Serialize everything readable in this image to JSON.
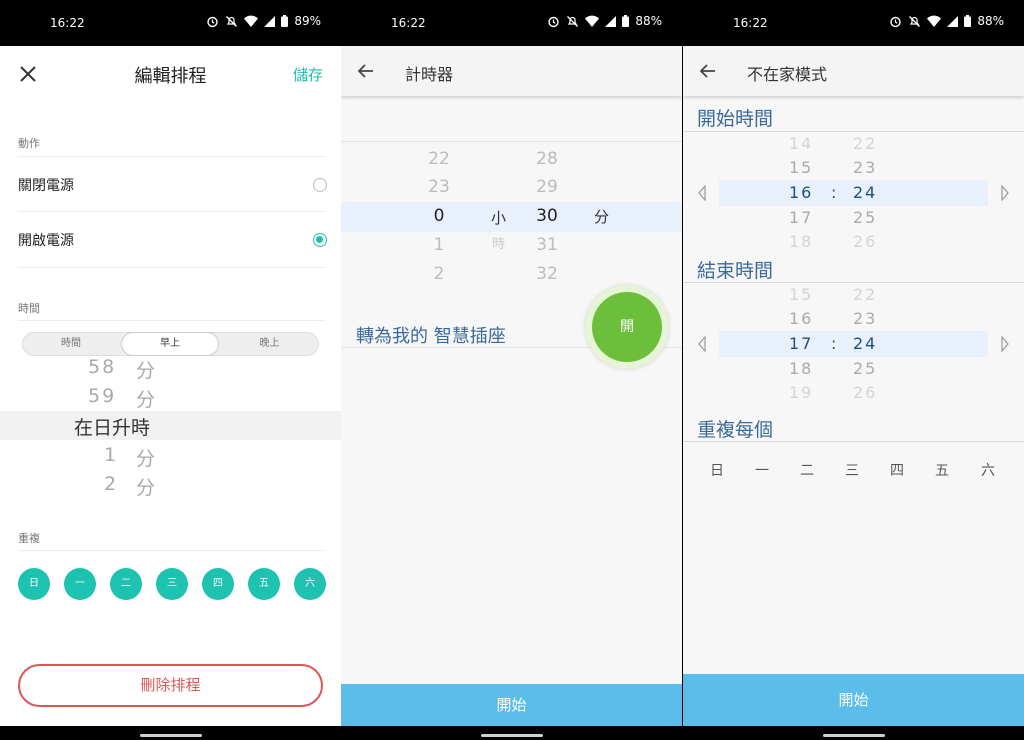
{
  "screens": [
    {
      "status": {
        "time": "16:22",
        "battery": "89%"
      },
      "header": {
        "title": "編輯排程",
        "save": "儲存"
      },
      "action_label": "動作",
      "options": [
        {
          "label": "關閉電源",
          "selected": false
        },
        {
          "label": "開啟電源",
          "selected": true
        }
      ],
      "time_label": "時間",
      "segments": [
        "時間",
        "早上",
        "晚上"
      ],
      "selected_segment": "早上",
      "wheel": {
        "above": [
          {
            "num": "58",
            "unit": "分"
          },
          {
            "num": "59",
            "unit": "分"
          }
        ],
        "selected": "在日升時",
        "below": [
          {
            "num": "1",
            "unit": "分"
          },
          {
            "num": "2",
            "unit": "分"
          }
        ]
      },
      "repeat_label": "重複",
      "days": [
        "日",
        "一",
        "二",
        "三",
        "四",
        "五",
        "六"
      ],
      "delete_label": "刪除排程"
    },
    {
      "status": {
        "time": "16:22",
        "battery": "88%"
      },
      "title": "計時器",
      "hours": {
        "above": [
          "22",
          "23"
        ],
        "selected": "0",
        "below": [
          "1",
          "2"
        ]
      },
      "hour_unit": "小",
      "hour_unit_2": "時",
      "minutes": {
        "above": [
          "28",
          "29"
        ],
        "selected": "30",
        "below": [
          "31",
          "32"
        ]
      },
      "minute_unit": "分",
      "convert_text": "轉為我的 智慧插座",
      "fab_label": "開",
      "start_label": "開始"
    },
    {
      "status": {
        "time": "16:22",
        "battery": "88%"
      },
      "title": "不在家模式",
      "start_time_label": "開始時間",
      "start_picker": {
        "hours": [
          "14",
          "15",
          "16",
          "17",
          "18"
        ],
        "minutes": [
          "22",
          "23",
          "24",
          "25",
          "26"
        ],
        "selected_index": 2
      },
      "end_time_label": "結束時間",
      "end_picker": {
        "hours": [
          "15",
          "16",
          "17",
          "18",
          "19"
        ],
        "minutes": [
          "22",
          "23",
          "24",
          "25",
          "26"
        ],
        "selected_index": 2
      },
      "separator": ":",
      "repeat_label": "重複每個",
      "weekdays": [
        "日",
        "一",
        "二",
        "三",
        "四",
        "五",
        "六"
      ],
      "start_label": "開始"
    }
  ],
  "colors": {
    "accent": "#1fbfae",
    "delete": "#e05555",
    "primary_button": "#5bbde9",
    "fab": "#6cbf3a",
    "heading": "#3a6a9c"
  }
}
